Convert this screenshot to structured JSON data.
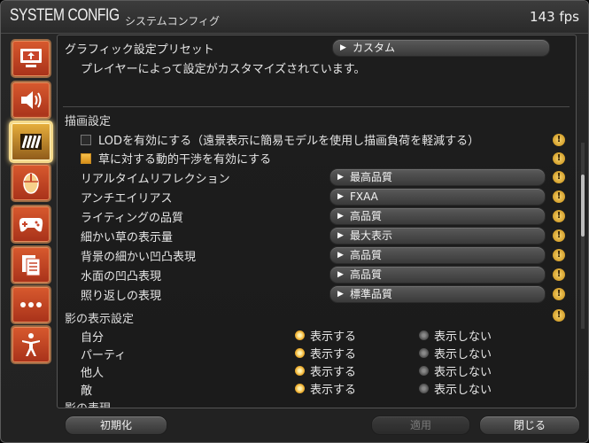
{
  "window": {
    "title": "SYSTEM CONFIG",
    "subtitle": "システムコンフィグ",
    "fps": "143 fps"
  },
  "sidebar": {
    "items": [
      {
        "icon": "display-settings-icon"
      },
      {
        "icon": "sound-settings-icon"
      },
      {
        "icon": "graphics-settings-icon",
        "active": true
      },
      {
        "icon": "mouse-settings-icon"
      },
      {
        "icon": "gamepad-settings-icon"
      },
      {
        "icon": "other-settings-icon"
      },
      {
        "icon": "more-settings-icon"
      },
      {
        "icon": "accessibility-settings-icon"
      }
    ]
  },
  "preset": {
    "label": "グラフィック設定プリセット",
    "value": "カスタム",
    "description": "プレイヤーによって設定がカスタマイズされています。"
  },
  "drawing": {
    "header": "描画設定",
    "checkboxes": [
      {
        "label": "LODを有効にする（遠景表示に簡易モデルを使用し描画負荷を軽減する）",
        "checked": false
      },
      {
        "label": "草に対する動的干渉を有効にする",
        "checked": true
      }
    ],
    "rows": [
      {
        "label": "リアルタイムリフレクション",
        "value": "最高品質"
      },
      {
        "label": "アンチエイリアス",
        "value": "FXAA"
      },
      {
        "label": "ライティングの品質",
        "value": "高品質"
      },
      {
        "label": "細かい草の表示量",
        "value": "最大表示"
      },
      {
        "label": "背景の細かい凹凸表現",
        "value": "高品質"
      },
      {
        "label": "水面の凹凸表現",
        "value": "高品質"
      },
      {
        "label": "照り返しの表現",
        "value": "標準品質"
      }
    ]
  },
  "shadows": {
    "header": "影の表示設定",
    "show_label": "表示する",
    "hide_label": "表示しない",
    "rows": [
      {
        "label": "自分",
        "selected": "show"
      },
      {
        "label": "パーティ",
        "selected": "show"
      },
      {
        "label": "他人",
        "selected": "show"
      },
      {
        "label": "敵",
        "selected": "show"
      }
    ],
    "next_header_partial": "影の表現"
  },
  "colors": {
    "accent": "#f0b030",
    "active_border": "#f4d98a",
    "category_button": "#c8452a"
  },
  "footer": {
    "reset_label": "初期化",
    "apply_label": "適用",
    "close_label": "閉じる"
  }
}
